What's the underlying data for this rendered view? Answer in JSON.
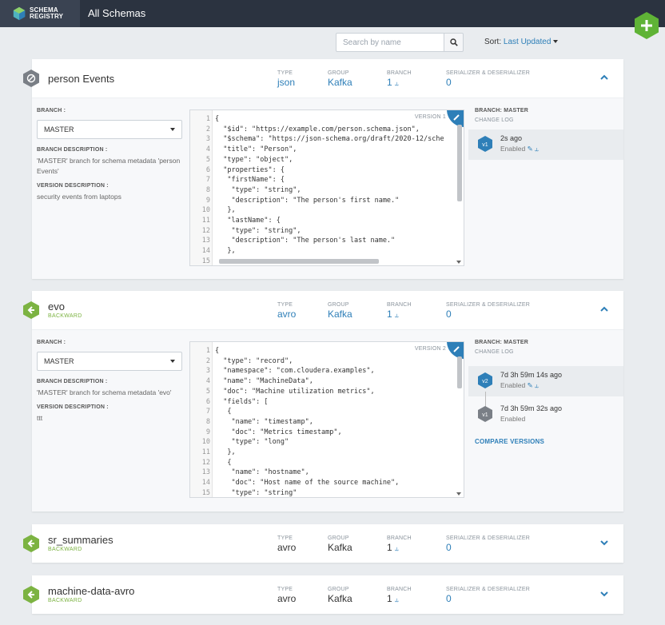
{
  "app": {
    "brand_line1": "SCHEMA",
    "brand_line2": "REGISTRY",
    "title": "All Schemas"
  },
  "toolbar": {
    "search_placeholder": "Search by name",
    "sort_label": "Sort:",
    "sort_value": "Last Updated"
  },
  "colors": {
    "topbar": "#2b3340",
    "accent_blue": "#2e7fb8",
    "compat_green": "#7cb342",
    "hex_gray": "#7a7f86"
  },
  "labels": {
    "type": "TYPE",
    "group": "GROUP",
    "branch": "BRANCH",
    "serializer": "SERIALIZER & DESERIALIZER",
    "branch_field": "BRANCH :",
    "branch_description": "BRANCH DESCRIPTION :",
    "version_description": "VERSION DESCRIPTION :",
    "change_log": "CHANGE LOG",
    "compare_versions": "COMPARE VERSIONS"
  },
  "schemas": [
    {
      "name": "person Events",
      "compatibility": "",
      "type": "json",
      "group": "Kafka",
      "branch_count": "1",
      "serializer_count": "0",
      "expanded": true,
      "icon": "blocked-icon",
      "branch_select": "MASTER",
      "branch_description": "'MASTER' branch for schema metadata 'person Events'",
      "version_description": "security events from laptops",
      "version_tag": "VERSION 1",
      "branch_title": "BRANCH: MASTER",
      "code_lines": [
        "{",
        "  \"$id\": \"https://example.com/person.schema.json\",",
        "  \"$schema\": \"https://json-schema.org/draft/2020-12/sche",
        "  \"title\": \"Person\",",
        "  \"type\": \"object\",",
        "  \"properties\": {",
        "   \"firstName\": {",
        "    \"type\": \"string\",",
        "    \"description\": \"The person's first name.\"",
        "   },",
        "   \"lastName\": {",
        "    \"type\": \"string\",",
        "    \"description\": \"The person's last name.\"",
        "   },",
        ""
      ],
      "versions": [
        {
          "label": "v1",
          "time": "2s ago",
          "status": "Enabled",
          "active": true
        }
      ]
    },
    {
      "name": "evo",
      "compatibility": "BACKWARD",
      "type": "avro",
      "group": "Kafka",
      "branch_count": "1",
      "serializer_count": "0",
      "expanded": true,
      "icon": "arrow-left-icon",
      "branch_select": "MASTER",
      "branch_description": "'MASTER' branch for schema metadata 'evo'",
      "version_description": "ttt",
      "version_tag": "VERSION 2",
      "branch_title": "BRANCH: MASTER",
      "code_lines": [
        "{",
        "  \"type\": \"record\",",
        "  \"namespace\": \"com.cloudera.examples\",",
        "  \"name\": \"MachineData\",",
        "  \"doc\": \"Machine utilization metrics\",",
        "  \"fields\": [",
        "   {",
        "    \"name\": \"timestamp\",",
        "    \"doc\": \"Metrics timestamp\",",
        "    \"type\": \"long\"",
        "   },",
        "   {",
        "    \"name\": \"hostname\",",
        "    \"doc\": \"Host name of the source machine\",",
        "    \"type\": \"string\""
      ],
      "versions": [
        {
          "label": "v2",
          "time": "7d 3h 59m 14s ago",
          "status": "Enabled",
          "active": true
        },
        {
          "label": "v1",
          "time": "7d 3h 59m 32s ago",
          "status": "Enabled",
          "active": false
        }
      ]
    },
    {
      "name": "sr_summaries",
      "compatibility": "BACKWARD",
      "type": "avro",
      "group": "Kafka",
      "branch_count": "1",
      "serializer_count": "0",
      "expanded": false,
      "icon": "arrow-left-icon"
    },
    {
      "name": "machine-data-avro",
      "compatibility": "BACKWARD",
      "type": "avro",
      "group": "Kafka",
      "branch_count": "1",
      "serializer_count": "0",
      "expanded": false,
      "icon": "arrow-left-icon"
    }
  ]
}
